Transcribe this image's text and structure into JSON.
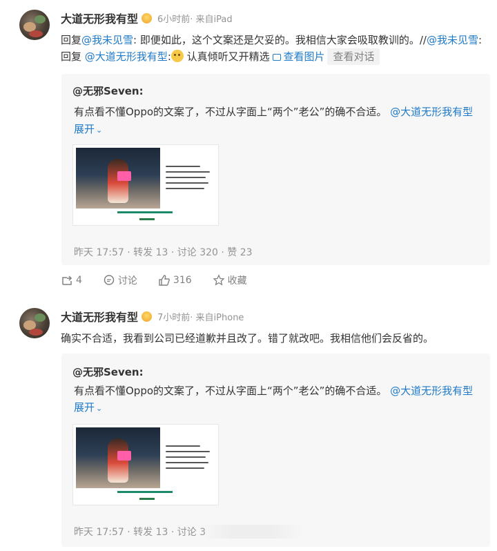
{
  "posts": [
    {
      "username": "大道无形我有型",
      "meta": "6小时前· 来自iPad",
      "body": {
        "reply_prefix": "回复",
        "mention_1": "@我未见雪",
        "text_1": ": 即便如此，这个文案还是欠妥的。我相信大家会吸取教训的。//",
        "mention_2": "@我未见雪",
        "text_2": ":回复",
        "mention_3": "@大道无形我有型",
        "text_3": ":",
        "text_4": " 认真倾听又开精选",
        "view_image": "查看图片",
        "view_dialog": "查看对话"
      },
      "quote": {
        "author": "@无邪Seven:",
        "text": "有点看不懂Oppo的文案了，不过从字面上“两个”老公”的确不合适。",
        "mention": "@大道无形我有型",
        "expand": "展开",
        "stats": "昨天 17:57 · 转发 13 · 讨论 320 · 赞 23"
      },
      "actions": {
        "repost_count": "4",
        "comment_label": "讨论",
        "like_count": "316",
        "favorite_label": "收藏"
      }
    },
    {
      "username": "大道无形我有型",
      "meta": "7小时前· 来自iPhone",
      "body": {
        "text": "确实不合适，我看到公司已经道歉并且改了。错了就改吧。我相信他们会反省的。"
      },
      "quote": {
        "author": "@无邪Seven:",
        "text": "有点看不懂Oppo的文案了，不过从字面上“两个”老公”的确不合适。",
        "mention": "@大道无形我有型",
        "expand": "展开",
        "stats": "昨天 17:57 · 转发 13 · 讨论 3"
      }
    }
  ],
  "colors": {
    "link": "#1f7ac9",
    "meta": "#939393",
    "quote_bg": "#f7f7f7"
  }
}
